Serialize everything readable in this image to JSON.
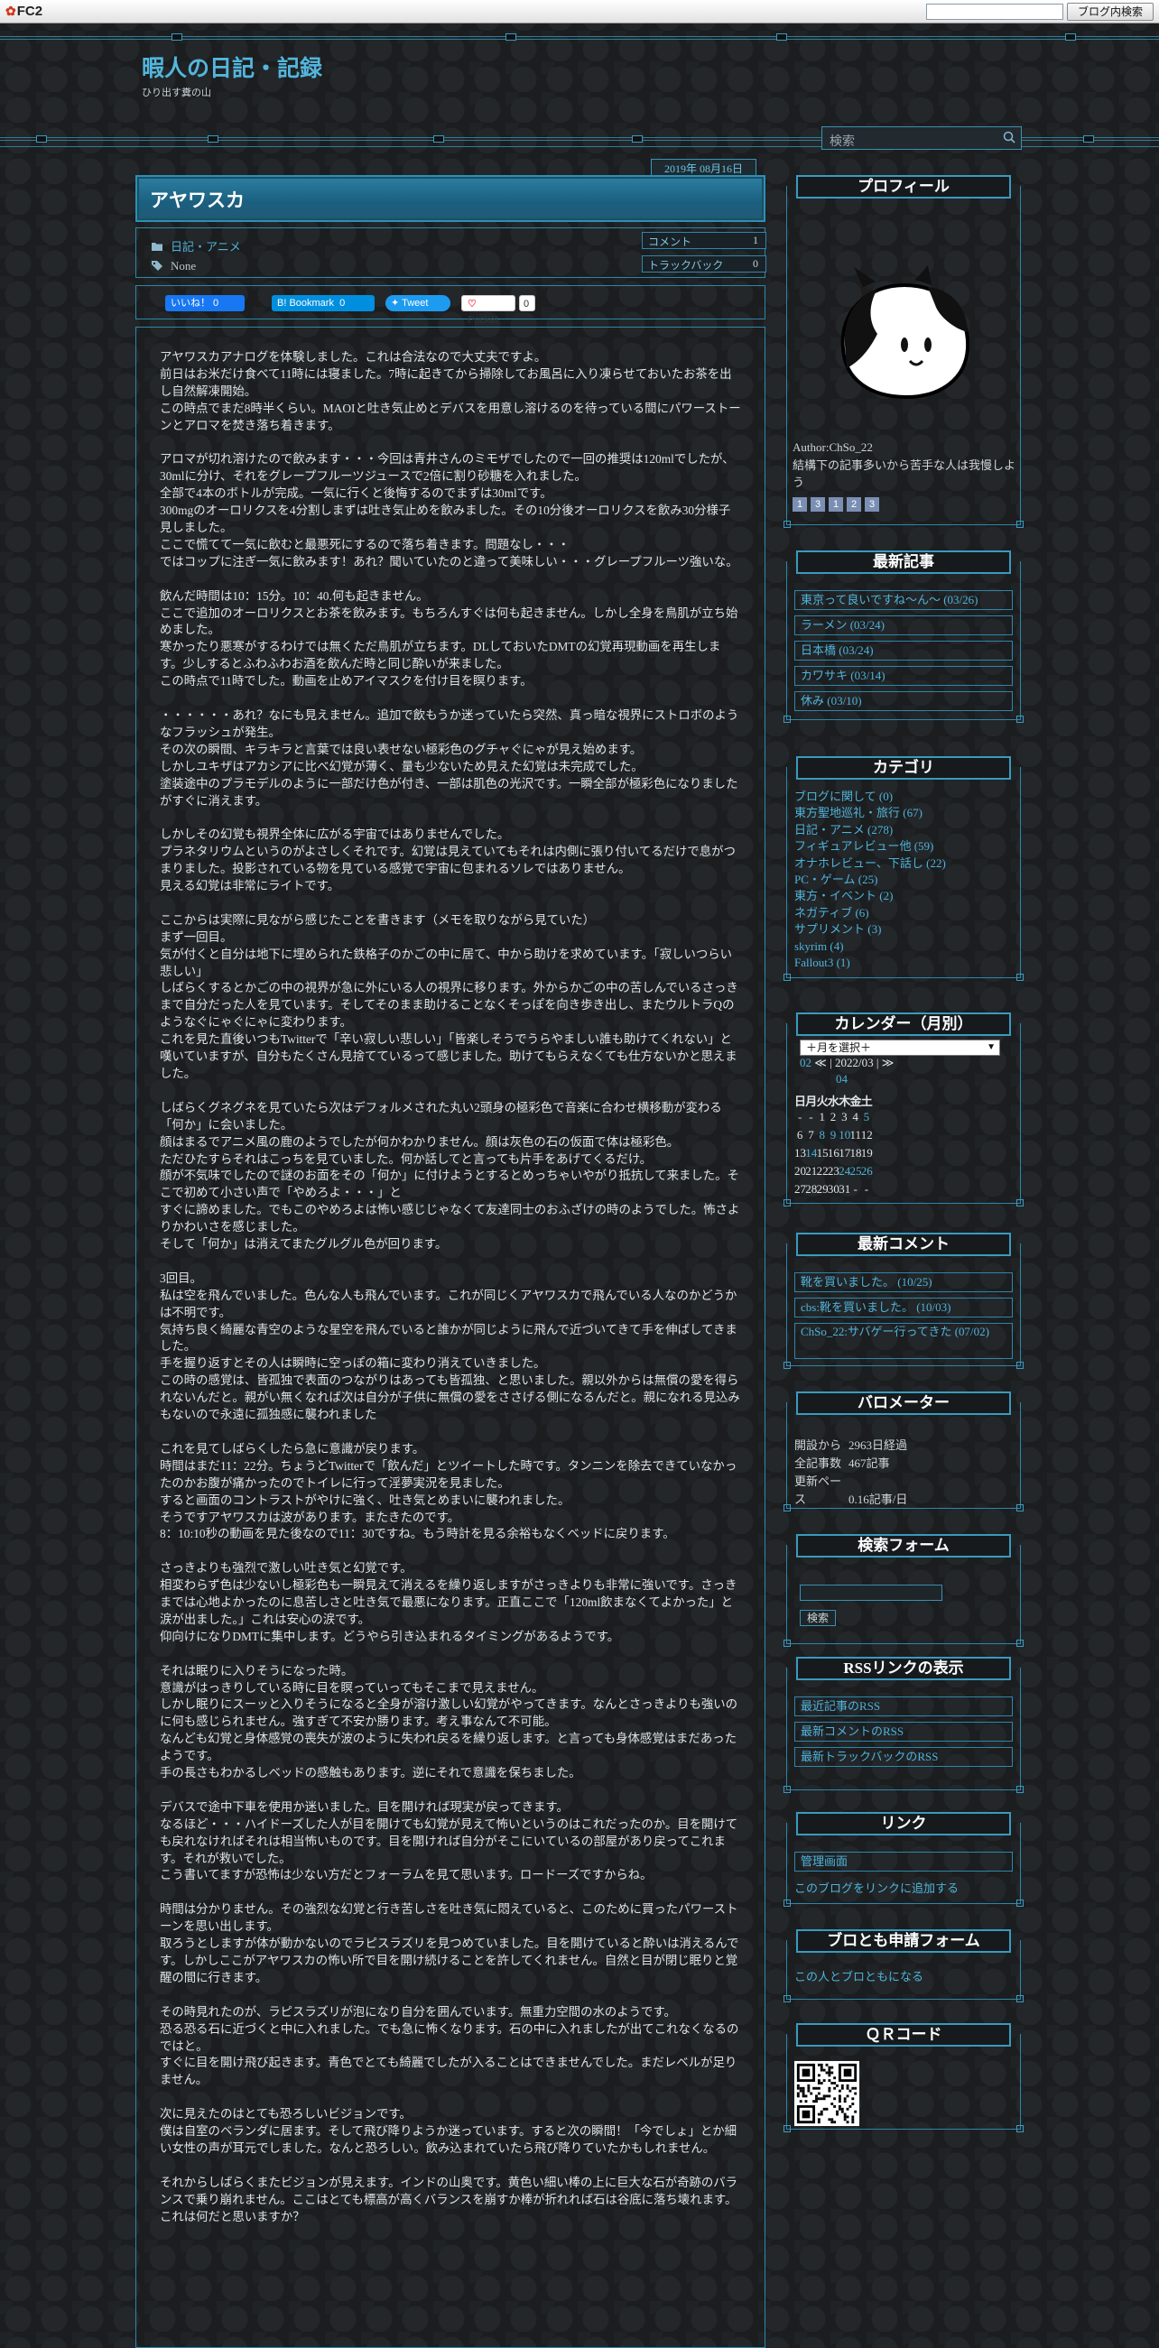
{
  "fc2": {
    "logo": "FC2",
    "search_button": "ブログ内検索"
  },
  "header": {
    "title": "暇人の日記・記録",
    "subtitle": "ひり出す糞の山",
    "search_placeholder": "検索"
  },
  "post": {
    "date": "2019年 08月16日",
    "title": "アヤワスカ",
    "category": "日記・アニメ",
    "tags": "None",
    "comment_label": "コメント",
    "comment_count": "1",
    "trackback_label": "トラックバック",
    "trackback_count": "0",
    "share": {
      "facebook": "いいね！ 0",
      "hatena": "B! Bookmark",
      "hatena_count": "0",
      "tweet": "Tweet",
      "pocket": "Pocket",
      "pocket_count": "0"
    },
    "paragraphs": [
      "アヤワスカアナログを体験しました。これは合法なので大丈夫ですよ。\n前日はお米だけ食べて11時には寝ました。7時に起きてから掃除してお風呂に入り凍らせておいたお茶を出し自然解凍開始。\nこの時点でまだ8時半くらい。MAOIと吐き気止めとデバスを用意し溶けるのを待っている間にパワーストーンとアロマを焚き落ち着きます。",
      "アロマが切れ溶けたので飲みます・・・今回は青井さんのミモザでしたので一回の推奨は120mlでしたが、30mlに分け、それをグレープフルーツジュースで2倍に割り砂糖を入れました。\n全部で4本のボトルが完成。一気に行くと後悔するのでまずは30mlです。\n300mgのオーロリクスを4分割しまずは吐き気止めを飲みました。その10分後オーロリクスを飲み30分様子見しました。\nここで慌てて一気に飲むと最悪死にするので落ち着きます。問題なし・・・\nではコップに注ぎ一気に飲みます！あれ？聞いていたのと違って美味しい・・・グレープフルーツ強いな。",
      "飲んだ時間は10：15分。10：40.何も起きません。\nここで追加のオーロリクスとお茶を飲みます。もちろんすぐは何も起きません。しかし全身を鳥肌が立ち始めました。\n寒かったり悪寒がするわけでは無くただ鳥肌が立ちます。DLしておいたDMTの幻覚再現動画を再生します。少しするとふわふわお酒を飲んだ時と同じ酔いが来ました。\nこの時点で11時でした。動画を止めアイマスクを付け目を瞑ります。",
      "・・・・・・あれ？なにも見えません。追加で飲もうか迷っていたら突然、真っ暗な視界にストロボのようなフラッシュが発生。\nその次の瞬間、キラキラと言葉では良い表せない極彩色のグチャぐにゃが見え始めます。\nしかしユキザはアカシアに比べ幻覚が薄く、量も少ないため見えた幻覚は未完成でした。\n塗装途中のプラモデルのように一部だけ色が付き、一部は肌色の光沢です。一瞬全部が極彩色になりましたがすぐに消えます。",
      "しかしその幻覚も視界全体に広がる宇宙ではありませんでした。\nプラネタリウムというのがよさしくそれです。幻覚は見えていてもそれは内側に張り付いてるだけで息がつまりました。投影されている物を見ている感覚で宇宙に包まれるソレではありません。\n見える幻覚は非常にライトです。",
      "ここからは実際に見ながら感じたことを書きます（メモを取りながら見ていた）\nまず一回目。\n気が付くと自分は地下に埋められた鉄格子のかごの中に居て、中から助けを求めています。「寂しいつらい悲しい」\nしばらくするとかごの中の視界が急に外にいる人の視界に移ります。外からかごの中の苦しんでいるさっきまで自分だった人を見ています。そしてそのまま助けることなくそっぽを向き歩き出し、またウルトラQのようなぐにゃぐにゃに変わります。\nこれを見た直後いつもTwitterで「辛い寂しい悲しい」「皆楽しそうでうらやましい誰も助けてくれない」と嘆いていますが、自分もたくさん見捨てているって感じました。助けてもらえなくても仕方ないかと思えました。",
      "しばらくグネグネを見ていたら次はデフォルメされた丸い2頭身の極彩色で音楽に合わせ横移動が変わる「何か」に会いました。\n顔はまるでアニメ風の鹿のようでしたが何かわかりません。顔は灰色の石の仮面で体は極彩色。\nただひたすらそれはこっちを見ていました。何か話してと言っても片手をあげてくるだけ。\n顔が不気味でしたので謎のお面をその「何か」に付けようとするとめっちゃいやがり抵抗して来ました。そこで初めて小さい声で「やめろよ・・・」と\nすぐに諦めました。でもこのやめろよは怖い感じじゃなくて友達同士のおふざけの時のようでした。怖さよりかわいさを感じました。\nそして「何か」は消えてまたグルグル色が回ります。",
      "3回目。\n私は空を飛んでいました。色んな人も飛んでいます。これが同じくアヤワスカで飛んでいる人なのかどうかは不明です。\n気持ち良く綺麗な青空のような星空を飛んでいると誰かが同じように飛んで近づいてきて手を伸ばしてきました。\n手を握り返すとその人は瞬時に空っぽの箱に変わり消えていきました。\nこの時の感覚は、皆孤独で表面のつながりはあっても皆孤独、と思いました。親以外からは無償の愛を得られないんだと。親がい無くなれば次は自分が子供に無償の愛をささげる側になるんだと。親になれる見込みもないので永遠に孤独感に襲われました",
      "これを見てしばらくしたら急に意識が戻ります。\n時間はまだ11：22分。ちょうどTwitterで「飲んだ」とツイートした時です。タンニンを除去できていなかったのかお腹が痛かったのでトイレに行って淫夢実況を見ました。\nすると画面のコントラストがやけに強く、吐き気とめまいに襲われました。\nそうですアヤワスカは波があります。またきたのです。\n8：10:10秒の動画を見た後なので11：30ですね。もう時計を見る余裕もなくベッドに戻ります。",
      "さっきよりも強烈で激しい吐き気と幻覚です。\n相変わらず色は少ないし極彩色も一瞬見えて消えるを繰り返しますがさっきよりも非常に強いです。さっきまでは心地よかったのに息苦しさと吐き気で最悪になります。正直ここで「120ml飲まなくてよかった」と涙が出ました。」これは安心の涙です。\n仰向けになりDMTに集中します。どうやら引き込まれるタイミングがあるようです。",
      "それは眠りに入りそうになった時。\n意識がはっきりしている時に目を瞑っていってもそこまで見えません。\nしかし眠りにスーッと入りそうになると全身が溶け激しい幻覚がやってきます。なんとさっきよりも強いのに何も感じられません。強すぎて不安か勝ります。考え事なんて不可能。\nなんども幻覚と身体感覚の喪失が波のように失われ戻るを繰り返します。と言っても身体感覚はまだあったようです。\n手の長さもわかるしベッドの感触もあります。逆にそれで意識を保ちました。",
      "デバスで途中下車を使用か迷いました。目を開ければ現実が戻ってきます。\nなるほど・・・ハイドーズした人が目を開けても幻覚が見えて怖いというのはこれだったのか。目を開けても戻れなければそれは相当怖いものです。目を開ければ自分がそこにいているの部屋があり戻ってこれます。それが救いでした。\nこう書いてますが恐怖は少ない方だとフォーラムを見て思います。ロードーズですからね。",
      "時間は分かりません。その強烈な幻覚と行き苦しさを吐き気に悶えていると、このために買ったパワーストーンを思い出します。\n取ろうとしますが体が動かないのでラピスラズリを見つめていました。目を開けていると酔いは消えるんです。しかしここがアヤワスカの怖い所で目を開け続けることを許してくれません。自然と目が閉じ眠りと覚醒の間に行きます。",
      "その時見れたのが、ラピスラズリが泡になり自分を囲んでいます。無重力空間の水のようです。\n恐る恐る石に近づくと中に入れました。でも急に怖くなります。石の中に入れましたが出てこれなくなるのではと。\nすぐに目を開け飛び起きます。青色でとても綺麗でしたが入ることはできませんでした。まだレベルが足りません。",
      "次に見えたのはとても恐ろしいビジョンです。\n僕は自室のベランダに居ます。そして飛び降りようか迷っています。すると次の瞬間！「今でしょ」とか細い女性の声が耳元でしました。なんと恐ろしい。飲み込まれていたら飛び降りていたかもしれません。",
      "それからしばらくまたビジョンが見えます。インドの山奥です。黄色い細い棒の上に巨大な石が奇跡のバランスで乗り崩れません。ここはとても標高が高くバランスを崩すか棒が折れれば石は谷底に落ち壊れます。\nこれは何だと思いますか？"
    ]
  },
  "sidebar": {
    "profile": {
      "title": "プロフィール",
      "author": "Author:ChSo_22",
      "desc": "結構下の記事多いから苦手な人は我慢しよう",
      "badges": [
        "1",
        "3",
        "1",
        "2",
        "3"
      ]
    },
    "recent": {
      "title": "最新記事",
      "items": [
        "東京って良いですね～ん～ (03/26)",
        "ラーメン (03/24)",
        "日本橋 (03/24)",
        "カワサキ (03/14)",
        "休み (03/10)"
      ]
    },
    "categories": {
      "title": "カテゴリ",
      "items": [
        "ブログに関して (0)",
        "東方聖地巡礼・旅行 (67)",
        "日記・アニメ (278)",
        "フィギュアレビュー他 (59)",
        "オナホレビュー、下話し (22)",
        "PC・ゲーム (25)",
        "東方・イベント (2)",
        "ネガティブ (6)",
        "サプリメント (3)",
        "skyrim (4)",
        "Fallout3 (1)"
      ]
    },
    "calendar": {
      "title": "カレンダー（月別）",
      "select": "＋月を選択＋",
      "prev": "02",
      "nav_prev": "≪",
      "current": "2022/03",
      "nav_next": "≫",
      "next": "04",
      "weekdays": [
        "日",
        "月",
        "火",
        "水",
        "木",
        "金",
        "土"
      ],
      "weeks": [
        [
          "-",
          "-",
          "1",
          "2",
          "3",
          "4",
          "5"
        ],
        [
          "6",
          "7",
          "8",
          "9",
          "10",
          "11",
          "12"
        ],
        [
          "13",
          "14",
          "15",
          "16",
          "17",
          "18",
          "19"
        ],
        [
          "20",
          "21",
          "22",
          "23",
          "24",
          "25",
          "26"
        ],
        [
          "27",
          "28",
          "29",
          "30",
          "31",
          "-",
          "-"
        ]
      ]
    },
    "comments": {
      "title": "最新コメント",
      "items": [
        "靴を買いました。 (10/25)",
        "cbs:靴を買いました。 (10/03)",
        "ChSo_22:サバゲー行ってきた (07/02)"
      ]
    },
    "barometer": {
      "title": "バロメーター",
      "rows": [
        {
          "label": "開設から",
          "value": "2963日経過"
        },
        {
          "label": "全記事数",
          "value": "467記事"
        },
        {
          "label": "更新ペース",
          "value": "0.16記事/日"
        }
      ]
    },
    "search": {
      "title": "検索フォーム",
      "button": "検索"
    },
    "rss": {
      "title": "RSSリンクの表示",
      "items": [
        "最近記事のRSS",
        "最新コメントのRSS",
        "最新トラックバックのRSS"
      ]
    },
    "links": {
      "title": "リンク",
      "items": [
        "管理画面"
      ],
      "add": "このブログをリンクに追加する"
    },
    "friend": {
      "title": "ブロとも申請フォーム",
      "link": "この人とブロともになる"
    },
    "qr": {
      "title": "ＱＲコード"
    }
  }
}
